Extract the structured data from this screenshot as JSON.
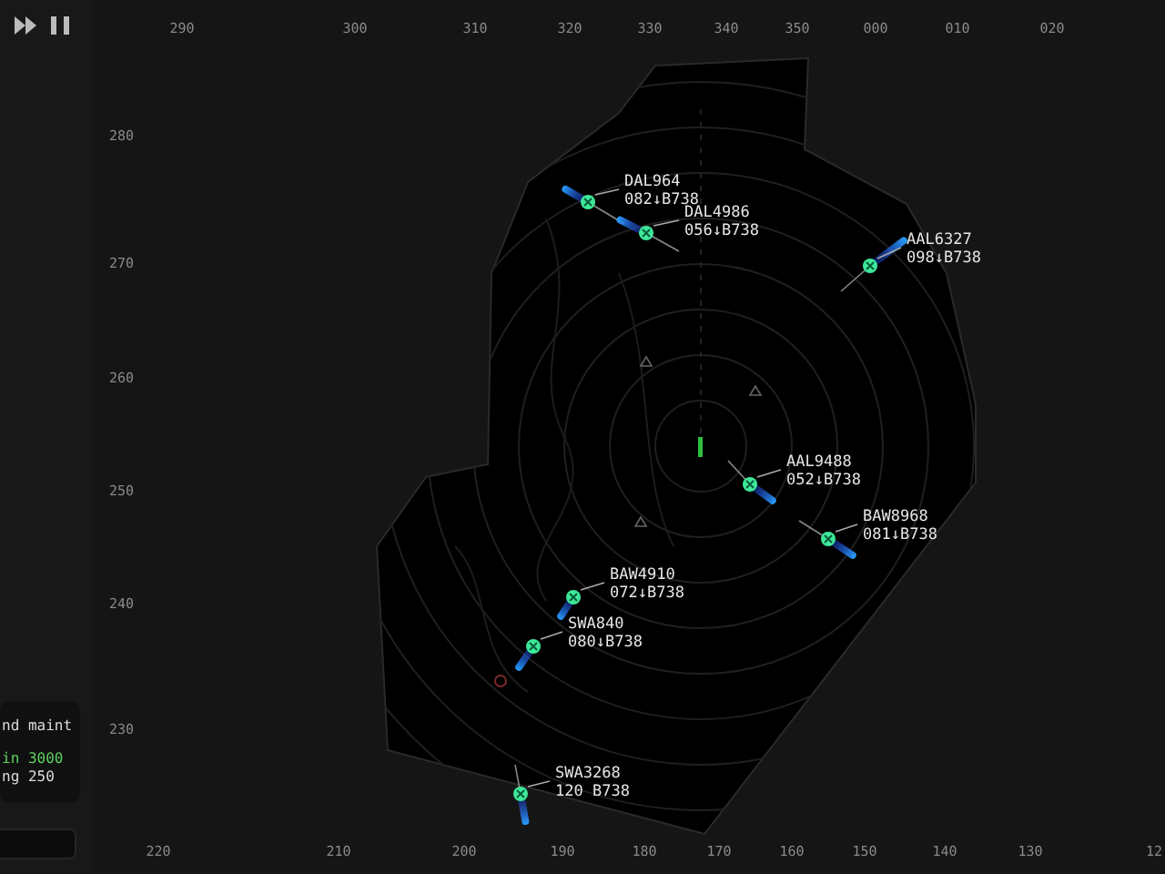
{
  "top_scale": [
    "290",
    "300",
    "310",
    "320",
    "330",
    "340",
    "350",
    "000",
    "010",
    "020"
  ],
  "left_scale": [
    "280",
    "270",
    "260",
    "250",
    "240",
    "230"
  ],
  "bottom_scale": [
    "220",
    "210",
    "200",
    "190",
    "180",
    "170",
    "160",
    "150",
    "140",
    "130",
    "12"
  ],
  "aircraft": [
    {
      "callsign": "DAL964",
      "data": "082↓B738"
    },
    {
      "callsign": "DAL4986",
      "data": "056↓B738"
    },
    {
      "callsign": "AAL6327",
      "data": "098↓B738"
    },
    {
      "callsign": "AAL9488",
      "data": "052↓B738"
    },
    {
      "callsign": "BAW8968",
      "data": "081↓B738"
    },
    {
      "callsign": "BAW4910",
      "data": "072↓B738"
    },
    {
      "callsign": "SWA840",
      "data": "080↓B738"
    },
    {
      "callsign": "SWA3268",
      "data": "120 B738"
    }
  ],
  "side_panel": {
    "lines": [
      {
        "text": "nd maint",
        "kind": "normal"
      },
      {
        "text": "in 3000",
        "kind": "cleared"
      },
      {
        "text": "ng 250",
        "kind": "normal"
      }
    ]
  }
}
